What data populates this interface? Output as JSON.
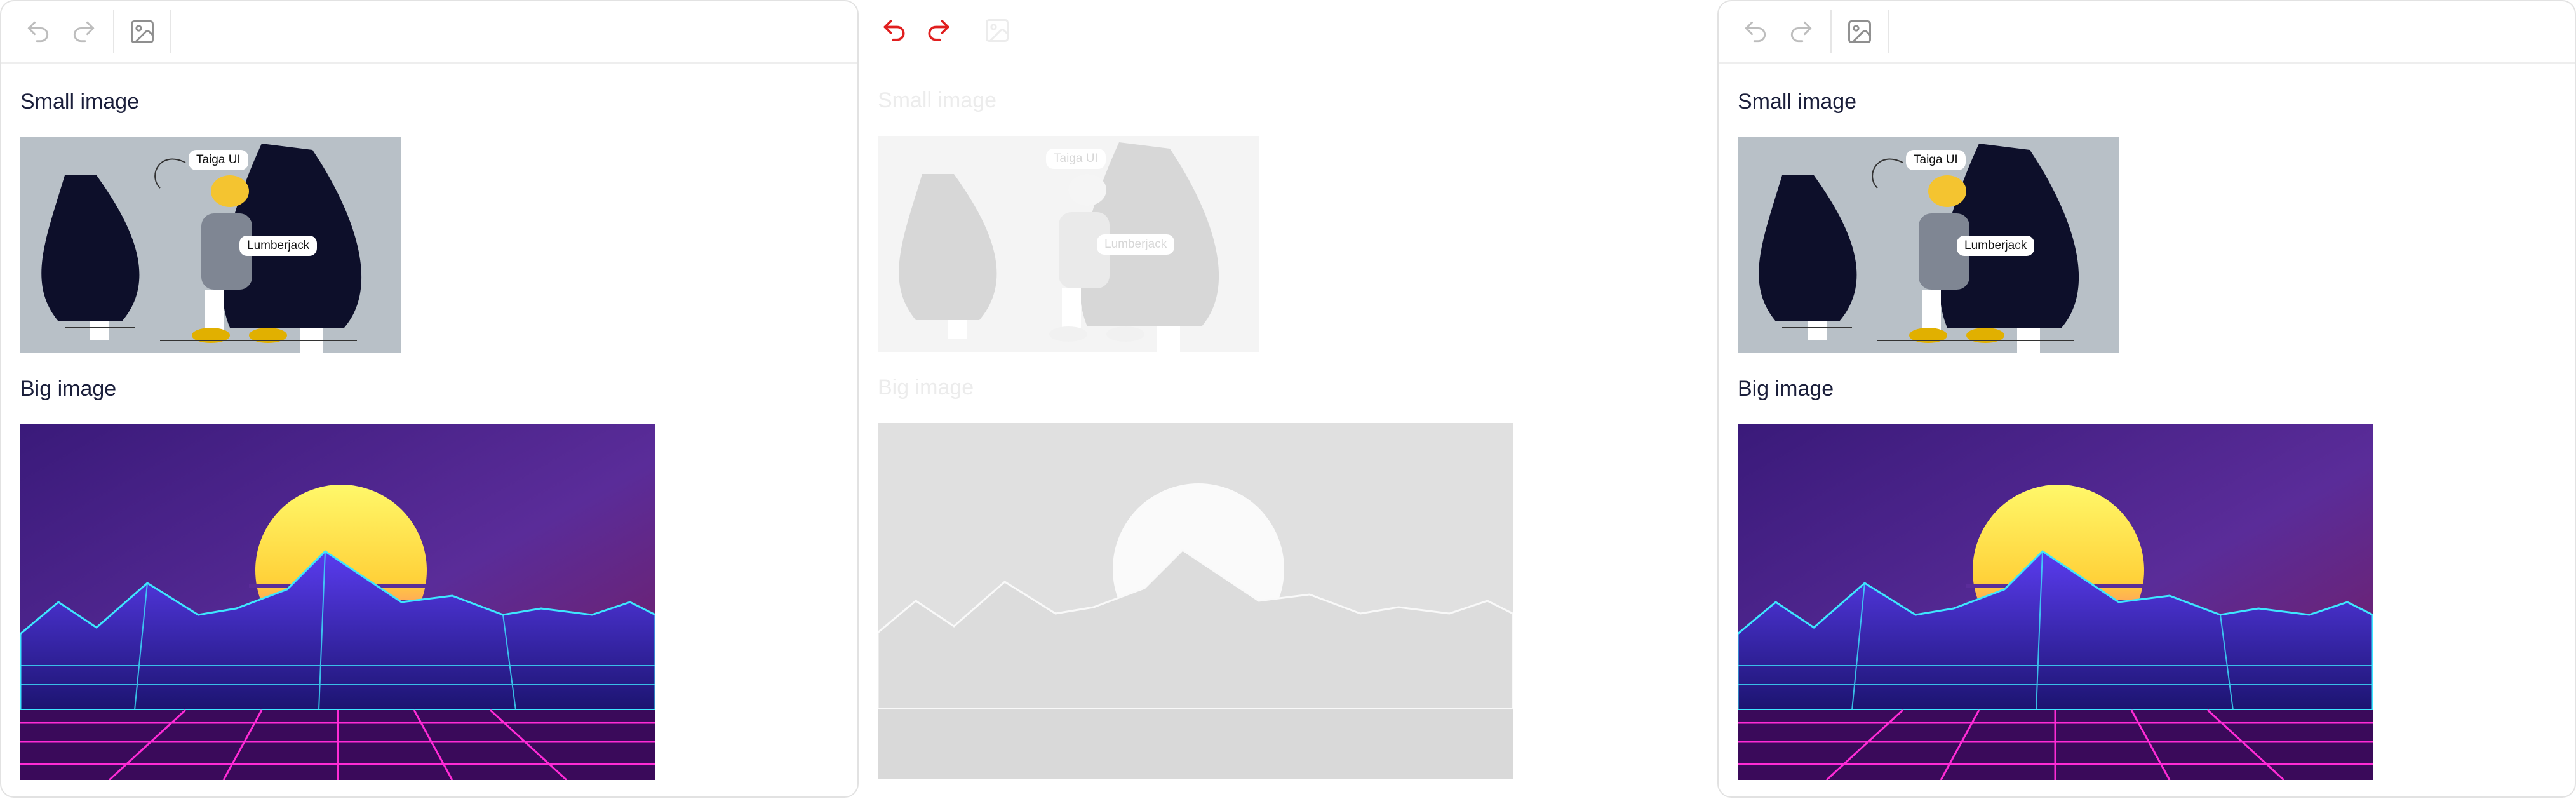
{
  "colors": {
    "icon_muted": "#b9b9b9",
    "icon_active": "#e01f1f",
    "text": "#1b1f3b",
    "text_faded": "#ececec",
    "border": "#e2e2e2"
  },
  "editors": [
    {
      "state": "normal",
      "toolbar": {
        "undo_icon": "undo-icon",
        "redo_icon": "redo-icon",
        "image_icon": "image-icon"
      },
      "small_image": {
        "heading": "Small image",
        "tag_top": "Taiga UI",
        "tag_bottom": "Lumberjack"
      },
      "big_image": {
        "heading": "Big image"
      }
    },
    {
      "state": "disabled",
      "toolbar": {
        "undo_icon": "undo-icon",
        "redo_icon": "redo-icon",
        "image_icon": "image-icon"
      },
      "small_image": {
        "heading": "Small image",
        "tag_top": "Taiga UI",
        "tag_bottom": "Lumberjack"
      },
      "big_image": {
        "heading": "Big image"
      }
    },
    {
      "state": "normal",
      "toolbar": {
        "undo_icon": "undo-icon",
        "redo_icon": "redo-icon",
        "image_icon": "image-icon"
      },
      "small_image": {
        "heading": "Small image",
        "tag_top": "Taiga UI",
        "tag_bottom": "Lumberjack"
      },
      "big_image": {
        "heading": "Big image"
      }
    }
  ]
}
